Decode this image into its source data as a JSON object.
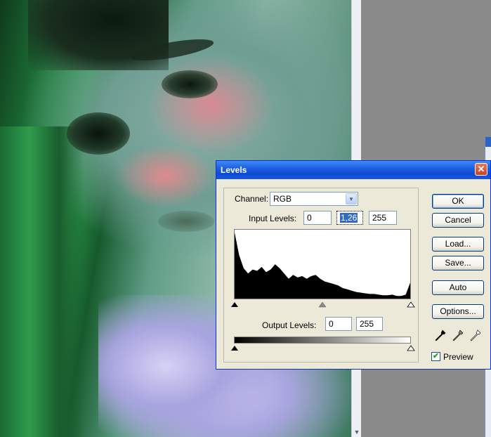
{
  "dialog": {
    "title": "Levels",
    "close_glyph": "✕",
    "channel": {
      "label": "Channel:",
      "value": "RGB"
    },
    "input_levels": {
      "label": "Input Levels:",
      "black": "0",
      "gamma": "1,26",
      "white": "255"
    },
    "output_levels": {
      "label": "Output Levels:",
      "black": "0",
      "white": "255"
    },
    "buttons": {
      "ok": "OK",
      "cancel": "Cancel",
      "load": "Load...",
      "save": "Save...",
      "auto": "Auto",
      "options": "Options..."
    },
    "preview": {
      "label": "Preview",
      "checked": true,
      "check_glyph": "✔"
    },
    "histogram_shape": [
      100,
      66,
      46,
      38,
      44,
      42,
      48,
      40,
      44,
      52,
      46,
      38,
      30,
      36,
      32,
      34,
      30,
      34,
      36,
      30,
      26,
      24,
      22,
      20,
      16,
      14,
      12,
      10,
      9,
      8,
      7,
      7,
      6,
      5,
      5,
      6,
      4,
      4,
      6,
      24
    ]
  },
  "icons": {
    "eyedroppers": [
      "black-eyedropper-icon",
      "gray-eyedropper-icon",
      "white-eyedropper-icon"
    ],
    "scroll_down": "▼"
  },
  "colors": {
    "titlebar": "#0f4bd4",
    "dialog_bg": "#ece9d8",
    "selection": "#316ac5"
  }
}
